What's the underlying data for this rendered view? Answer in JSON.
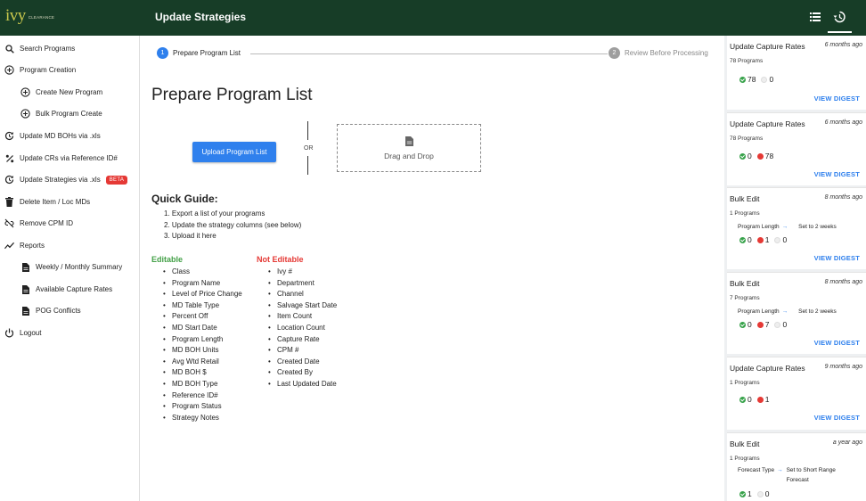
{
  "app": {
    "logo_text": "ivy",
    "logo_sub": "CLEARANCE",
    "page_heading": "Update Strategies"
  },
  "topbar": {
    "icons": [
      "list-icon",
      "history-icon"
    ]
  },
  "sidebar": {
    "items": [
      {
        "label": "Search Programs",
        "icon": "search-icon"
      },
      {
        "label": "Program Creation",
        "icon": "add-circle-icon"
      },
      {
        "label": "Create New Program",
        "icon": "add-circle-icon"
      },
      {
        "label": "Bulk Program Create",
        "icon": "add-circle-icon"
      },
      {
        "label": "Update MD BOHs via .xls",
        "icon": "update-icon"
      },
      {
        "label": "Update CRs via Reference ID#",
        "icon": "percent-icon"
      },
      {
        "label": "Update Strategies via .xls",
        "icon": "update-icon",
        "badge": "BETA"
      },
      {
        "label": "Delete Item / Loc MDs",
        "icon": "trash-icon"
      },
      {
        "label": "Remove CPM ID",
        "icon": "link-off-icon"
      },
      {
        "label": "Reports",
        "icon": "trend-icon"
      },
      {
        "label": "Weekly / Monthly Summary",
        "icon": "document-icon"
      },
      {
        "label": "Available Capture Rates",
        "icon": "document-icon"
      },
      {
        "label": "POG Conflicts",
        "icon": "document-icon"
      },
      {
        "label": "Logout",
        "icon": "power-icon"
      }
    ]
  },
  "stepper": {
    "step1": {
      "num": "1",
      "label": "Prepare Program List"
    },
    "step2": {
      "num": "2",
      "label": "Review Before Processing"
    }
  },
  "main": {
    "title": "Prepare Program List",
    "upload_label": "Upload Program List",
    "or_label": "OR",
    "drop_label": "Drag and Drop",
    "guide_title": "Quick Guide:",
    "guide_steps": [
      "1. Export a list of your programs",
      "2. Update the strategy columns (see below)",
      "3. Upload it here"
    ],
    "editable_title": "Editable",
    "editable": [
      "Class",
      "Program Name",
      "Level of Price Change",
      "MD Table Type",
      "Percent Off",
      "MD Start Date",
      "Program Length",
      "MD BOH Units",
      "Avg Wtd Retail",
      "MD BOH $",
      "MD BOH Type",
      "Reference ID#",
      "Program Status",
      "Strategy Notes"
    ],
    "noneditable_title": "Not Editable",
    "noneditable": [
      "Ivy #",
      "Department",
      "Channel",
      "Salvage Start Date",
      "Item Count",
      "Location Count",
      "Capture Rate",
      "CPM #",
      "Created Date",
      "Created By",
      "Last Updated Date"
    ]
  },
  "history": {
    "view_digest_label": "VIEW DIGEST",
    "cards": [
      {
        "title": "Update Capture Rates",
        "time": "6 months ago",
        "count": "78 Programs",
        "success": "78",
        "fail": null,
        "skipped": "0"
      },
      {
        "title": "Update Capture Rates",
        "time": "6 months ago",
        "count": "78 Programs",
        "success": "0",
        "fail": "78",
        "skipped": null
      },
      {
        "title": "Bulk Edit",
        "time": "8 months ago",
        "count": "1 Programs",
        "field": "Program Length",
        "change": "Set to 2 weeks",
        "success": "0",
        "fail": "1",
        "skipped": "0"
      },
      {
        "title": "Bulk Edit",
        "time": "8 months ago",
        "count": "7 Programs",
        "field": "Program Length",
        "change": "Set to 2 weeks",
        "success": "0",
        "fail": "7",
        "skipped": "0"
      },
      {
        "title": "Update Capture Rates",
        "time": "9 months ago",
        "count": "1 Programs",
        "success": "0",
        "fail": "1",
        "skipped": null
      },
      {
        "title": "Bulk Edit",
        "time": "a year ago",
        "count": "1 Programs",
        "field": "Forecast Type",
        "change": "Set to Short Range Forecast",
        "success": "1",
        "fail": null,
        "skipped": "0"
      }
    ]
  },
  "colors": {
    "topbar": "#173d27",
    "primary": "#2f80ed",
    "editable": "#43a047",
    "not_editable": "#e53935"
  }
}
